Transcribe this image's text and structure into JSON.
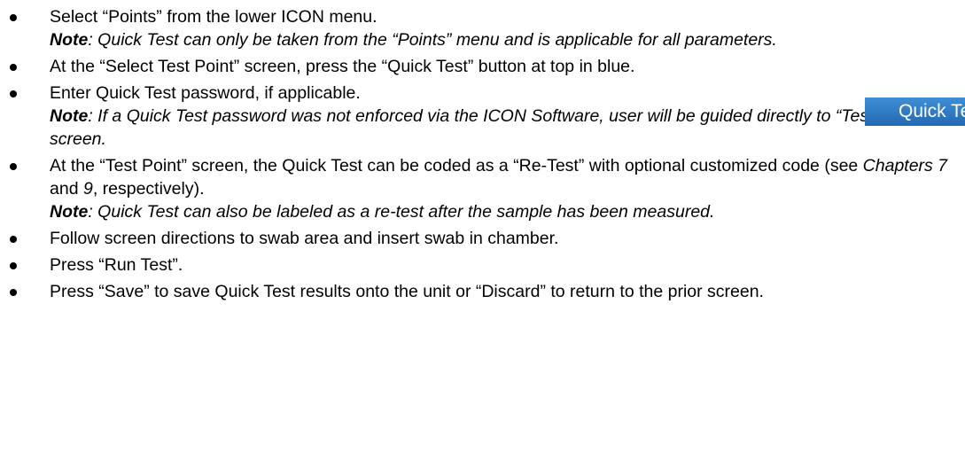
{
  "steps": [
    {
      "text": "Select “Points” from the lower ICON menu.",
      "note_label": "Note",
      "note_text": ": Quick Test can only be taken from the “Points” menu and is applicable for all parameters."
    },
    {
      "text": "At the “Select Test Point” screen, press the “Quick Test” button at top in blue."
    },
    {
      "text": "Enter Quick Test password, if applicable.",
      "note_label": "Note",
      "note_text": ": If a Quick Test password was not enforced via the ICON Software, user will be guided directly to “Test Point” screen."
    },
    {
      "text_a": "At the “Test Point” screen, the Quick Test can be coded as a “Re-Test” with optional customized code (see ",
      "ref_1": "Chapters 7",
      "text_b": " and ",
      "ref_2": "9",
      "text_c": ", respectively).",
      "note_label": "Note",
      "note_text": ": Quick Test can also be labeled as a re-test after the sample has been measured."
    },
    {
      "text": "Follow screen directions to swab area and insert swab in chamber."
    },
    {
      "text": "Press “Run Test”."
    },
    {
      "text": "Press “Save” to save Quick Test results onto the unit or “Discard” to return to the prior screen."
    }
  ],
  "quick_test_button": {
    "label": "Quick Test",
    "color": "#2f7cc8"
  }
}
